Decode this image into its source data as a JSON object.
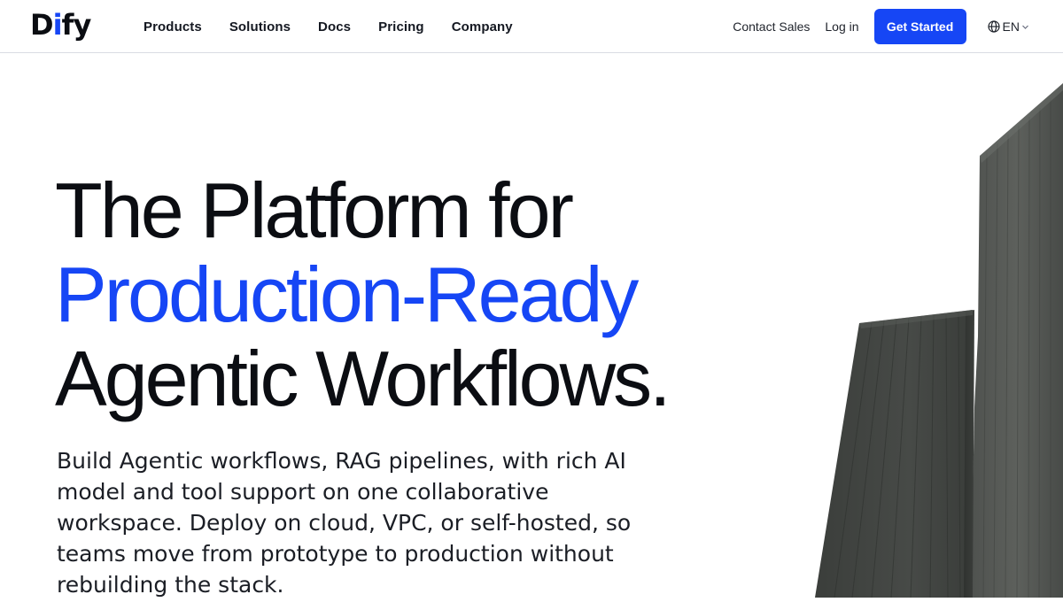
{
  "brand": {
    "logo_prefix": "D",
    "logo_accent": "i",
    "logo_suffix": "fy",
    "accent_color": "#1646f5"
  },
  "nav": {
    "items": [
      {
        "label": "Products"
      },
      {
        "label": "Solutions"
      },
      {
        "label": "Docs"
      },
      {
        "label": "Pricing"
      },
      {
        "label": "Company"
      }
    ],
    "contact_sales": "Contact Sales",
    "login": "Log in",
    "cta": "Get Started",
    "language": "EN",
    "language_icon": "globe-icon",
    "language_chevron_icon": "chevron-down-icon"
  },
  "hero": {
    "title_line1": "The Platform for",
    "title_line2": "Production-Ready",
    "title_line3": "Agentic Workflows.",
    "description": "Build Agentic workflows, RAG pipelines, with rich AI model and tool support on one collaborative workspace. Deploy on cloud, VPC, or self-hosted, so teams move from prototype to production without rebuilding the stack."
  }
}
